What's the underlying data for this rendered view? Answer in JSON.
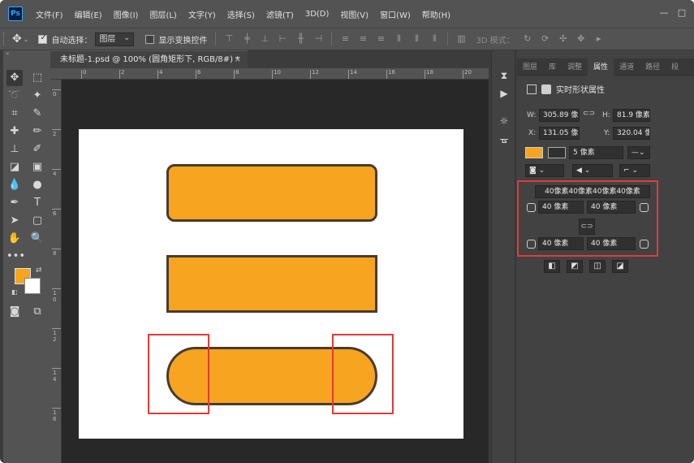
{
  "app": {
    "logo": "Ps"
  },
  "menu": [
    "文件(F)",
    "编辑(E)",
    "图像(I)",
    "图层(L)",
    "文字(Y)",
    "选择(S)",
    "滤镜(T)",
    "3D(D)",
    "视图(V)",
    "窗口(W)",
    "帮助(H)"
  ],
  "window_controls": {
    "minimize": "—",
    "restore": "□"
  },
  "options": {
    "auto_select_label": "自动选择：",
    "auto_select_checked": true,
    "auto_select_target": "图层",
    "show_transform_label": "显示变换控件",
    "show_transform_checked": false,
    "mode_3d_label": "3D 模式："
  },
  "document": {
    "tab_title": "未标题-1.psd @ 100% (圆角矩形下, RGB/8#) *",
    "ruler_top": [
      "0",
      "2",
      "4",
      "6",
      "8",
      "10",
      "12",
      "14",
      "16",
      "18",
      "20"
    ],
    "ruler_left": [
      "0",
      "2",
      "4",
      "6",
      "8",
      "1\n0",
      "1\n2",
      "1\n4",
      "1\n6"
    ],
    "shape_fill": "#f7a520",
    "shape_stroke": "#4a3b2c",
    "highlight_color": "#e23b3b"
  },
  "tools": {
    "foreground_color": "#f7a520",
    "background_color": "#ffffff"
  },
  "panel": {
    "tabs": [
      "图层",
      "库",
      "调整",
      "属性",
      "通道",
      "路径",
      "段"
    ],
    "active_tab": "属性",
    "title": "实时形状属性",
    "w_label": "W:",
    "w_value": "305.89 像",
    "h_label": "H:",
    "h_value": "81.9 像素",
    "x_label": "X:",
    "x_value": "131.05 像",
    "y_label": "Y:",
    "y_value": "320.04 像",
    "stroke_width": "5 像素",
    "radius_summary": "40像素40像素40像素40像素",
    "radius_top_left": "40 像素",
    "radius_top_right": "40 像素",
    "radius_bottom_left": "40 像素",
    "radius_bottom_right": "40 像素"
  }
}
